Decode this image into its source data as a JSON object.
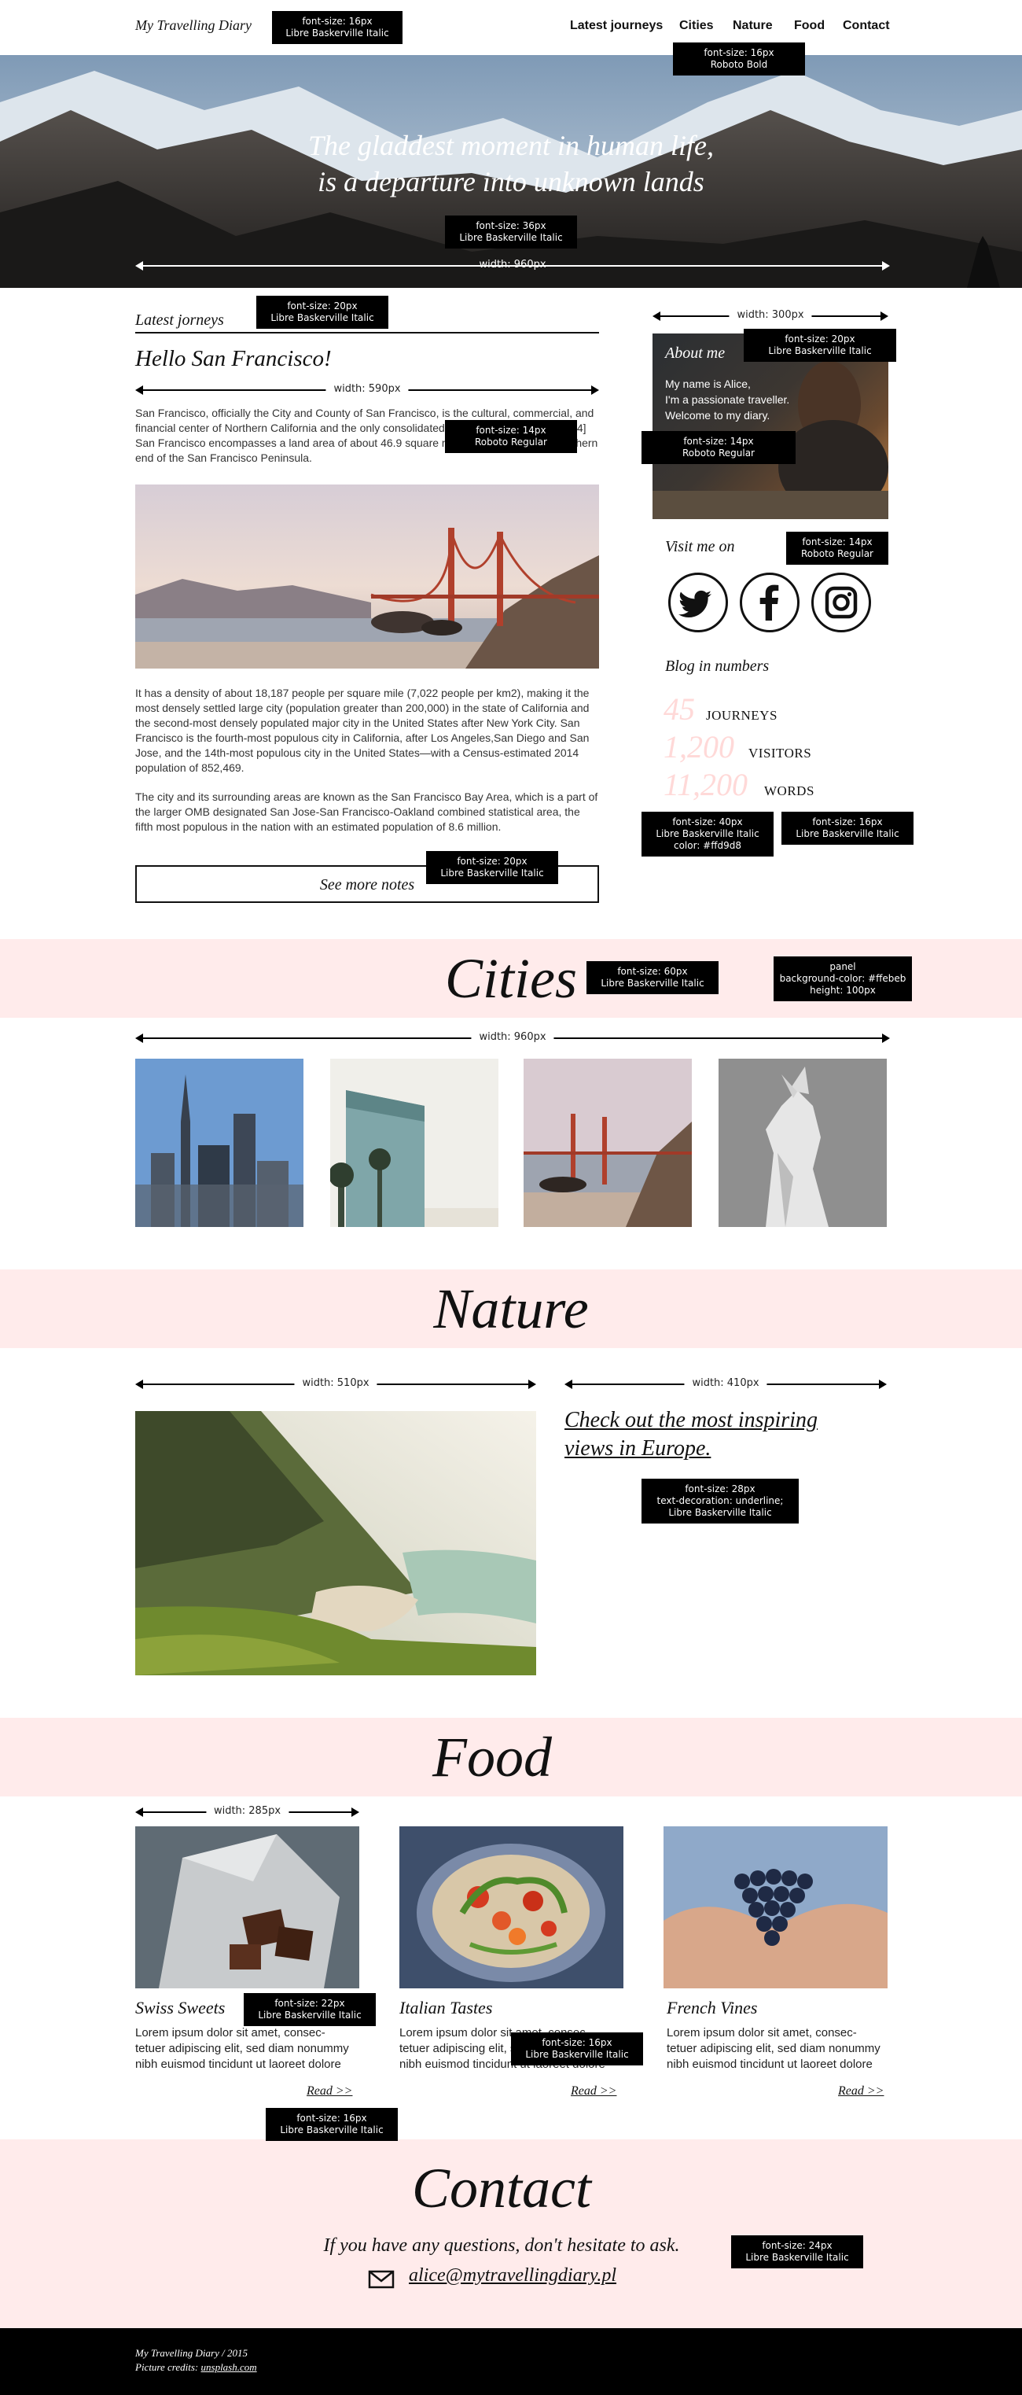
{
  "header": {
    "brand": "My Travelling Diary",
    "nav": [
      "Latest journeys",
      "Cities",
      "Nature",
      "Food",
      "Contact"
    ]
  },
  "hero": {
    "quote_line1": "The gladdest moment in human life,",
    "quote_line2": "is a departure into unknown lands"
  },
  "latest": {
    "heading": "Latest jorneys",
    "post_title": "Hello San Francisco!",
    "para1": "San Francisco, officially the City and County of San Francisco, is the cultural, commercial, and financial center of Northern California and the only consolidated city-county in California. [24] San Francisco encompasses a land area of about 46.9 square miles (121 km2) on the northern end of the San Francisco Peninsula.",
    "para2": "It has a density of about 18,187 people per square mile (7,022 people per km2), making it the most densely settled large city (population greater than 200,000) in the state of California and the second-most densely populated major city in the United States after New York City. San Francisco is the fourth-most populous city in California, after Los Angeles,San Diego and San Jose, and the 14th-most populous city in the United States—with a Census-estimated 2014 population of 852,469.",
    "para3": "The city and its surrounding areas are known as the San Francisco Bay Area, which is a part of the larger OMB designated San Jose-San Francisco-Oakland combined statistical area, the fifth most populous in the nation with an estimated population of 8.6 million.",
    "more_button": "See more notes"
  },
  "sidebar": {
    "about_title": "About me",
    "about_line1": "My name is Alice,",
    "about_line2": "I'm a passionate traveller.",
    "about_line3": "Welcome to my diary.",
    "visit_title": "Visit me on",
    "social_icons": [
      "twitter-icon",
      "facebook-icon",
      "instagram-icon"
    ],
    "numbers_title": "Blog in numbers",
    "stats": [
      {
        "num": "45",
        "label": "JOURNEYS"
      },
      {
        "num": "1,200",
        "label": "VISITORS"
      },
      {
        "num": "11,200",
        "label": "WORDS"
      }
    ],
    "stat_color": "#ffd9d8"
  },
  "cities": {
    "title": "Cities"
  },
  "nature": {
    "title": "Nature",
    "link_line1": "Check out the most inspiring",
    "link_line2": "views in Europe."
  },
  "food": {
    "title": "Food",
    "items": [
      {
        "title": "Swiss Sweets",
        "text1": "Lorem ipsum dolor sit amet, consec-",
        "text2": "tetuer adipiscing elit, sed diam nonummy",
        "text3": "nibh euismod tincidunt ut laoreet dolore",
        "read": "Read >>"
      },
      {
        "title": "Italian Tastes",
        "text1": "Lorem ipsum dolor sit amet, consec-",
        "text2": "tetuer adipiscing elit, sed diam nonummy",
        "text3": "nibh euismod tincidunt ut laoreet dolore",
        "read": "Read >>"
      },
      {
        "title": "French Vines",
        "text1": "Lorem ipsum dolor sit amet, consec-",
        "text2": "tetuer adipiscing elit, sed diam nonummy",
        "text3": "nibh euismod tincidunt ut laoreet dolore",
        "read": "Read >>"
      }
    ]
  },
  "contact": {
    "title": "Contact",
    "prompt": "If you have any questions, don't hesitate to ask.",
    "email": "alice@mytravellingdiary.pl"
  },
  "footer": {
    "line1": "My Travelling Diary / 2015",
    "credits_prefix": "Picture credits: ",
    "credits_link": "unsplash.com"
  },
  "annotations": {
    "nav_font": "font-size: 16px\nLibre Baskerville Italic",
    "nav_font2": "font-size: 16px\nRoboto Bold",
    "hero_font": "font-size: 36px\nLibre Baskerville Italic",
    "hero_width": "width: 960px",
    "latest_font": "font-size: 20px\nLibre Baskerville Italic",
    "content_width": "width: 590px",
    "body_font": "font-size: 14px\nRoboto Regular",
    "sidebar_width": "width: 300px",
    "about_font": "font-size: 20px\nLibre Baskerville Italic",
    "about_text_font": "font-size: 14px\nRoboto Regular",
    "visit_font": "font-size: 14px\nRoboto Regular",
    "stat_num_font": "font-size: 40px\nLibre Baskerville Italic\ncolor: #ffd9d8",
    "stat_word_font": "font-size: 16px\nLibre Baskerville Italic",
    "more_font": "font-size: 20px\nLibre Baskerville Italic",
    "cities_font": "font-size: 60px\nLibre Baskerville Italic",
    "panel_spec": "panel\nbackground-color: #ffebeb\nheight: 100px",
    "cities_width": "width: 960px",
    "nature_left_width": "width: 510px",
    "nature_right_width": "width: 410px",
    "nature_link_font": "font-size: 28px\ntext-decoration: underline;\nLibre Baskerville Italic",
    "food_width": "width: 285px",
    "food_title_font": "font-size: 22px\nLibre Baskerville Italic",
    "food_text_font": "font-size: 16px\nLibre Baskerville Italic",
    "read_font": "font-size: 16px\nLibre Baskerville Italic",
    "contact_font": "font-size: 24px\nLibre Baskerville Italic"
  }
}
